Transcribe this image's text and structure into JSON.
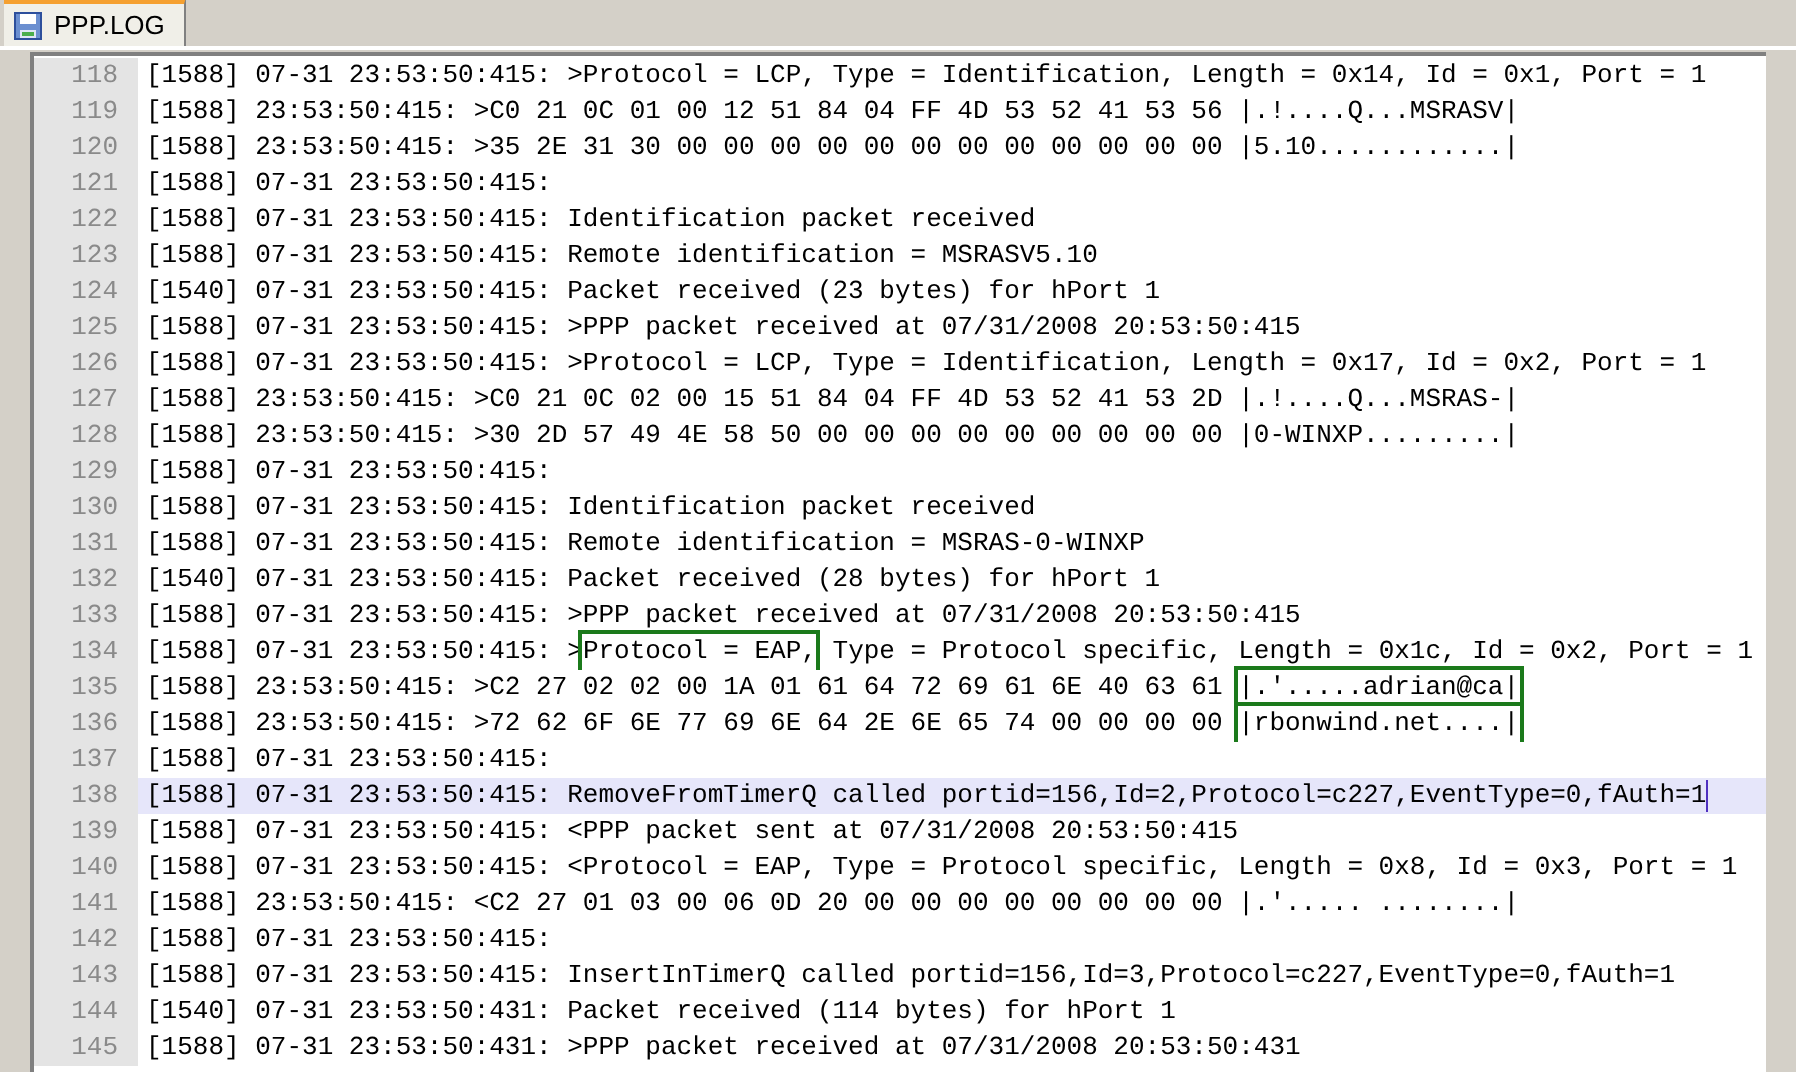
{
  "tab": {
    "label": "PPP.LOG",
    "selected": true
  },
  "lines": [
    {
      "number": "118",
      "selected": false,
      "text": "[1588] 07-31 23:53:50:415: >Protocol = LCP, Type = Identification, Length = 0x14, Id = 0x1, Port = 1"
    },
    {
      "number": "119",
      "selected": false,
      "text": "[1588] 23:53:50:415: >C0 21 0C 01 00 12 51 84 04 FF 4D 53 52 41 53 56 |.!....Q...MSRASV|"
    },
    {
      "number": "120",
      "selected": false,
      "text": "[1588] 23:53:50:415: >35 2E 31 30 00 00 00 00 00 00 00 00 00 00 00 00 |5.10............|"
    },
    {
      "number": "121",
      "selected": false,
      "text": "[1588] 07-31 23:53:50:415:"
    },
    {
      "number": "122",
      "selected": false,
      "text": "[1588] 07-31 23:53:50:415: Identification packet received"
    },
    {
      "number": "123",
      "selected": false,
      "text": "[1588] 07-31 23:53:50:415: Remote identification = MSRASV5.10"
    },
    {
      "number": "124",
      "selected": false,
      "text": "[1540] 07-31 23:53:50:415: Packet received (23 bytes) for hPort 1"
    },
    {
      "number": "125",
      "selected": false,
      "text": "[1588] 07-31 23:53:50:415: >PPP packet received at 07/31/2008 20:53:50:415"
    },
    {
      "number": "126",
      "selected": false,
      "text": "[1588] 07-31 23:53:50:415: >Protocol = LCP, Type = Identification, Length = 0x17, Id = 0x2, Port = 1"
    },
    {
      "number": "127",
      "selected": false,
      "text": "[1588] 23:53:50:415: >C0 21 0C 02 00 15 51 84 04 FF 4D 53 52 41 53 2D |.!....Q...MSRAS-|"
    },
    {
      "number": "128",
      "selected": false,
      "text": "[1588] 23:53:50:415: >30 2D 57 49 4E 58 50 00 00 00 00 00 00 00 00 00 |0-WINXP.........|"
    },
    {
      "number": "129",
      "selected": false,
      "text": "[1588] 07-31 23:53:50:415:"
    },
    {
      "number": "130",
      "selected": false,
      "text": "[1588] 07-31 23:53:50:415: Identification packet received"
    },
    {
      "number": "131",
      "selected": false,
      "text": "[1588] 07-31 23:53:50:415: Remote identification = MSRAS-0-WINXP"
    },
    {
      "number": "132",
      "selected": false,
      "text": "[1540] 07-31 23:53:50:415: Packet received (28 bytes) for hPort 1"
    },
    {
      "number": "133",
      "selected": false,
      "text": "[1588] 07-31 23:53:50:415: >PPP packet received at 07/31/2008 20:53:50:415"
    },
    {
      "number": "134",
      "selected": false,
      "segments": [
        {
          "text": "[1588] 07-31 23:53:50:415: >",
          "boxed": false
        },
        {
          "text": "Protocol = EAP,",
          "boxed": true
        },
        {
          "text": " Type = Protocol specific, Length = 0x1c, Id = 0x2, Port = 1",
          "boxed": false
        }
      ]
    },
    {
      "number": "135",
      "selected": false,
      "segments": [
        {
          "text": "[1588] 23:53:50:415: >C2 27 02 02 00 1A 01 61 64 72 69 61 6E 40 63 61 ",
          "boxed": false
        },
        {
          "text": "|.'.....adrian@ca|",
          "boxed": true
        }
      ]
    },
    {
      "number": "136",
      "selected": false,
      "segments": [
        {
          "text": "[1588] 23:53:50:415: >72 62 6F 6E 77 69 6E 64 2E 6E 65 74 00 00 00 00 ",
          "boxed": false
        },
        {
          "text": "|rbonwind.net....|",
          "boxed": true
        }
      ]
    },
    {
      "number": "137",
      "selected": false,
      "text": "[1588] 07-31 23:53:50:415:"
    },
    {
      "number": "138",
      "selected": true,
      "text": "[1588] 07-31 23:53:50:415: RemoveFromTimerQ called portid=156,Id=2,Protocol=c227,EventType=0,fAuth=1"
    },
    {
      "number": "139",
      "selected": false,
      "text": "[1588] 07-31 23:53:50:415: <PPP packet sent at 07/31/2008 20:53:50:415"
    },
    {
      "number": "140",
      "selected": false,
      "text": "[1588] 07-31 23:53:50:415: <Protocol = EAP, Type = Protocol specific, Length = 0x8, Id = 0x3, Port = 1"
    },
    {
      "number": "141",
      "selected": false,
      "text": "[1588] 23:53:50:415: <C2 27 01 03 00 06 0D 20 00 00 00 00 00 00 00 00 |.'..... ........|"
    },
    {
      "number": "142",
      "selected": false,
      "text": "[1588] 07-31 23:53:50:415:"
    },
    {
      "number": "143",
      "selected": false,
      "text": "[1588] 07-31 23:53:50:415: InsertInTimerQ called portid=156,Id=3,Protocol=c227,EventType=0,fAuth=1"
    },
    {
      "number": "144",
      "selected": false,
      "text": "[1540] 07-31 23:53:50:431: Packet received (114 bytes) for hPort 1"
    },
    {
      "number": "145",
      "selected": false,
      "text": "[1588] 07-31 23:53:50:431: >PPP packet received at 07/31/2008 20:53:50:431"
    }
  ]
}
